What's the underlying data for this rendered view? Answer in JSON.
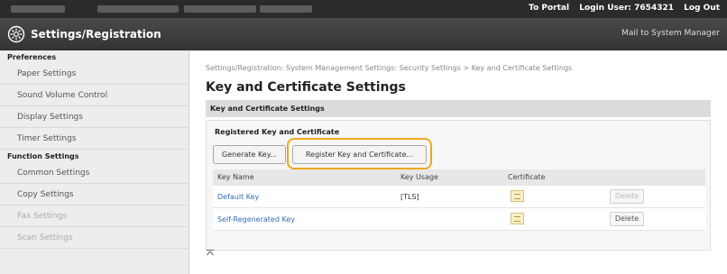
{
  "topbar": {
    "portal_label": "To Portal",
    "login_label": "Login User: 7654321",
    "logout_label": "Log Out"
  },
  "header": {
    "title": "Settings/Registration",
    "mail_link": "Mail to System Manager"
  },
  "sidebar": {
    "groups": [
      {
        "label": "Preferences",
        "items": [
          "Paper Settings",
          "Sound Volume Control",
          "Display Settings",
          "Timer Settings"
        ]
      },
      {
        "label": "Function Settings",
        "items": [
          "Common Settings",
          "Copy Settings",
          "Fax Settings",
          "Scan Settings"
        ]
      }
    ]
  },
  "main": {
    "breadcrumb": "Settings/Registration: System Management Settings: Security Settings > Key and Certificate Settings",
    "page_title": "Key and Certificate Settings",
    "section_title": "Key and Certificate Settings",
    "registered_title": "Registered Key and Certificate",
    "buttons": {
      "generate": "Generate Key...",
      "register": "Register Key and Certificate..."
    },
    "table": {
      "headers": [
        "Key Name",
        "Key Usage",
        "Certificate"
      ],
      "rows": [
        {
          "name": "Default Key",
          "usage": "[TLS]",
          "delete": "Delete",
          "delete_enabled": false
        },
        {
          "name": "Self-Regenerated Key",
          "usage": "",
          "delete": "Delete",
          "delete_enabled": true
        }
      ]
    }
  },
  "colors": {
    "highlight": "#f0a81c",
    "link": "#2f6db5",
    "header_bg": "#333333"
  }
}
